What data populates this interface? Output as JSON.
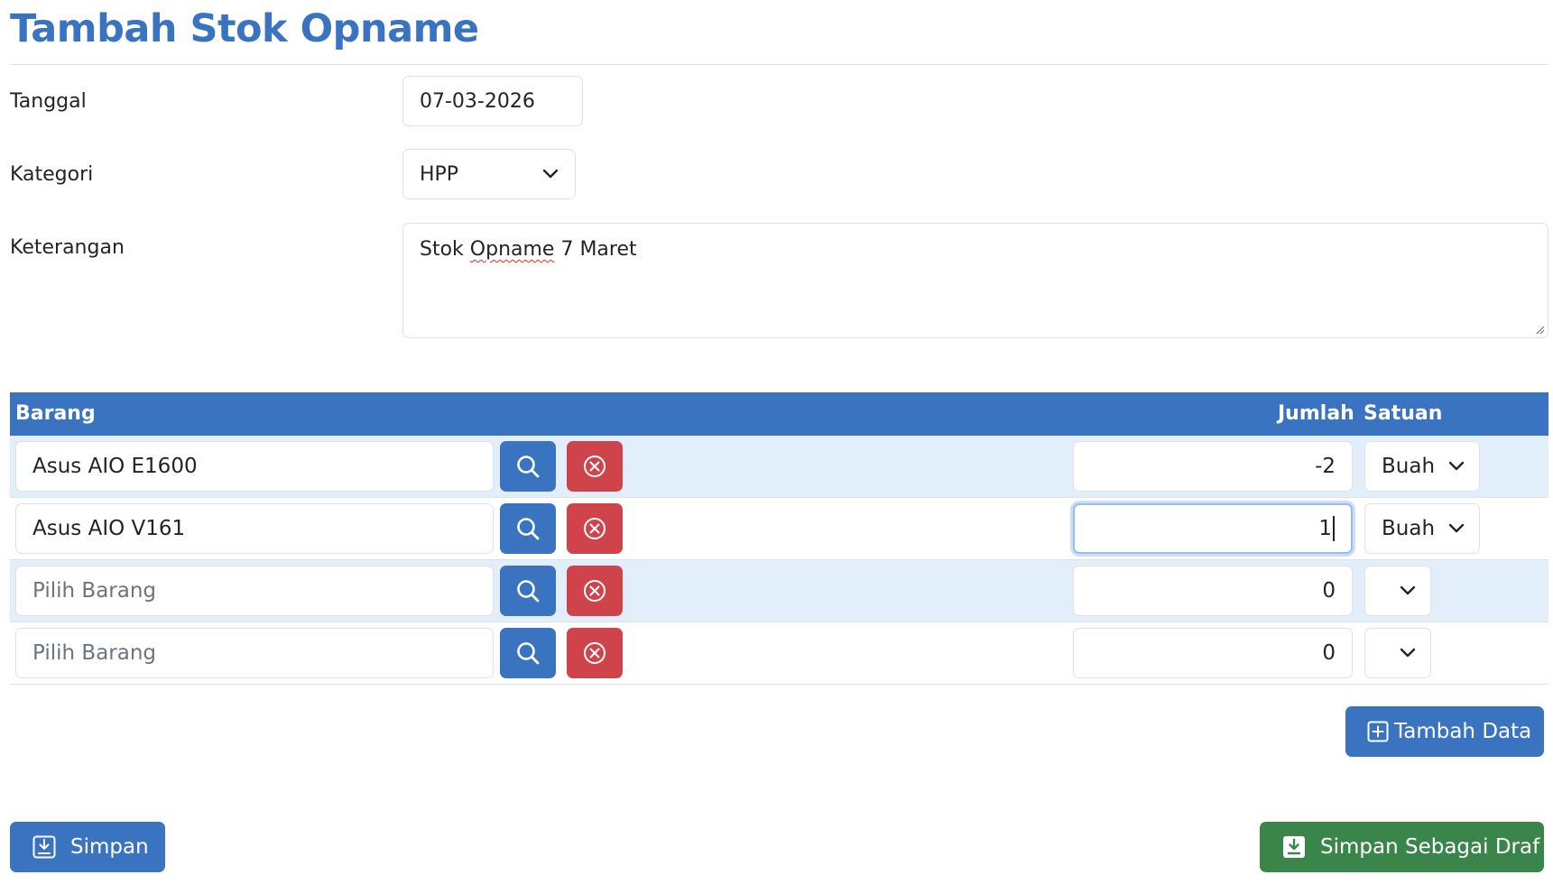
{
  "page": {
    "title": "Tambah Stok Opname"
  },
  "form": {
    "tanggal_label": "Tanggal",
    "tanggal_value": "07-03-2026",
    "kategori_label": "Kategori",
    "kategori_value": "HPP",
    "keterangan_label": "Keterangan",
    "keterangan_value_pre": "Stok ",
    "keterangan_value_misspelled": "Opname",
    "keterangan_value_post": " 7 Maret"
  },
  "table": {
    "headers": {
      "barang": "Barang",
      "jumlah": "Jumlah",
      "satuan": "Satuan"
    },
    "rows": [
      {
        "barang": "Asus AIO E1600",
        "placeholder": false,
        "jumlah": "-2",
        "satuan": "Buah"
      },
      {
        "barang": "Asus AIO V161",
        "placeholder": false,
        "jumlah": "1",
        "satuan": "Buah"
      },
      {
        "barang": "Pilih Barang",
        "placeholder": true,
        "jumlah": "0",
        "satuan": ""
      },
      {
        "barang": "Pilih Barang",
        "placeholder": true,
        "jumlah": "0",
        "satuan": ""
      }
    ]
  },
  "buttons": {
    "tambah_data": "Tambah Data",
    "simpan": "Simpan",
    "simpan_draf": "Simpan Sebagai Draf"
  },
  "colors": {
    "primary": "#3a74c1",
    "danger": "#cf444b",
    "success": "#3a8549",
    "row_stripe": "#e2eefa"
  },
  "icons": {
    "search": "search-icon",
    "remove": "x-circle-icon",
    "chevron": "chevron-down-icon",
    "plus_square": "plus-square-icon",
    "save": "save-icon",
    "save_fill": "save-fill-icon"
  }
}
